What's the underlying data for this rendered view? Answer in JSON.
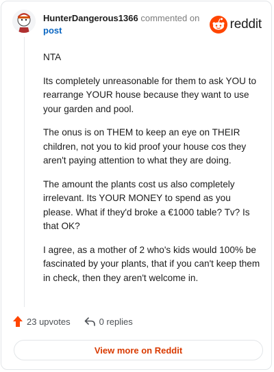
{
  "comment": {
    "username": "HunterDangerous1366",
    "action": "commented on",
    "link_text": "post",
    "paragraphs": [
      "NTA",
      "Its completely unreasonable for them to ask YOU to rearrange YOUR house because they want to use your garden and pool.",
      "The onus is on THEM to keep an eye on THEIR children, not you to kid proof your house cos they aren't paying attention to what they are doing.",
      "The amount the plants cost us also completely irrelevant. Its YOUR MONEY to spend as you please. What if they'd broke a €1000 table? Tv? Is that OK?",
      "I agree, as a mother of 2 who's kids would 100% be fascinated by your plants, that if you can't keep them in check, then they aren't welcome in."
    ]
  },
  "brand": {
    "wordmark": "reddit",
    "color": "#ff4500"
  },
  "footer": {
    "upvotes": "23 upvotes",
    "replies": "0 replies",
    "upvote_icon": "upvote-arrow-icon",
    "reply_icon": "reply-arrow-icon"
  },
  "cta": {
    "label": "View more on Reddit",
    "color": "#d93a00"
  },
  "avatar": {
    "icon": "avatar-icon"
  }
}
